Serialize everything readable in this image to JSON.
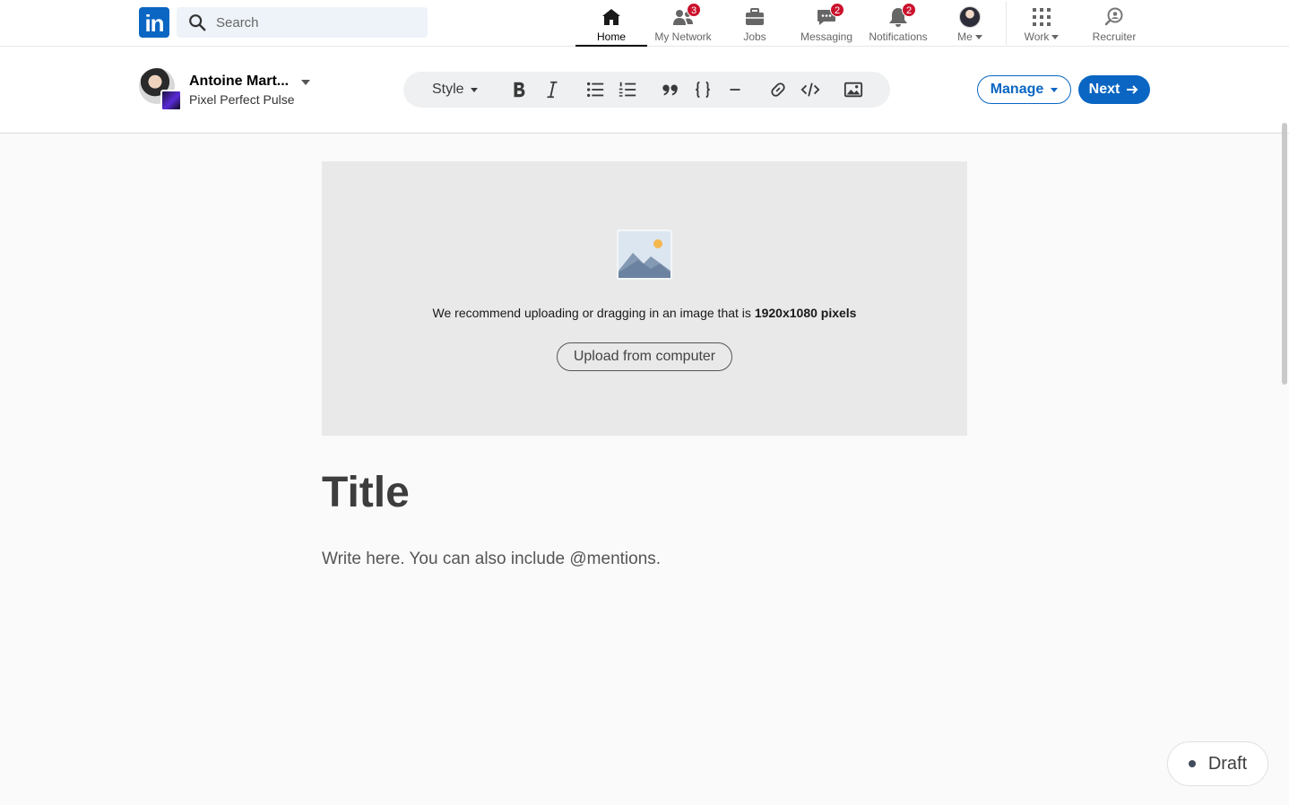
{
  "nav": {
    "logo": "in",
    "search_placeholder": "Search",
    "items": [
      {
        "label": "Home",
        "badge": ""
      },
      {
        "label": "My Network",
        "badge": "3"
      },
      {
        "label": "Jobs",
        "badge": ""
      },
      {
        "label": "Messaging",
        "badge": "2"
      },
      {
        "label": "Notifications",
        "badge": "2"
      },
      {
        "label": "Me",
        "badge": ""
      },
      {
        "label": "Work",
        "badge": ""
      },
      {
        "label": "Recruiter",
        "badge": ""
      }
    ],
    "active": "Home"
  },
  "editor": {
    "author_name": "Antoine Mart...",
    "author_page": "Pixel Perfect Pulse",
    "toolbar": {
      "style_label": "Style",
      "icons": [
        "bold-icon",
        "italic-icon",
        "bulleted-list-icon",
        "numbered-list-icon",
        "quote-icon",
        "code-block-icon",
        "divider-icon",
        "link-icon",
        "embed-icon",
        "image-icon"
      ]
    },
    "manage_label": "Manage",
    "next_label": "Next"
  },
  "cover": {
    "recommend_text": "We recommend uploading or dragging in an image that is ",
    "recommend_size": "1920x1080 pixels",
    "upload_label": "Upload from computer"
  },
  "article": {
    "title_placeholder": "Title",
    "body_placeholder": "Write here. You can also include @mentions."
  },
  "status": {
    "label": "Draft"
  },
  "colors": {
    "brand": "#0a66c2",
    "badge": "#cb112d"
  }
}
